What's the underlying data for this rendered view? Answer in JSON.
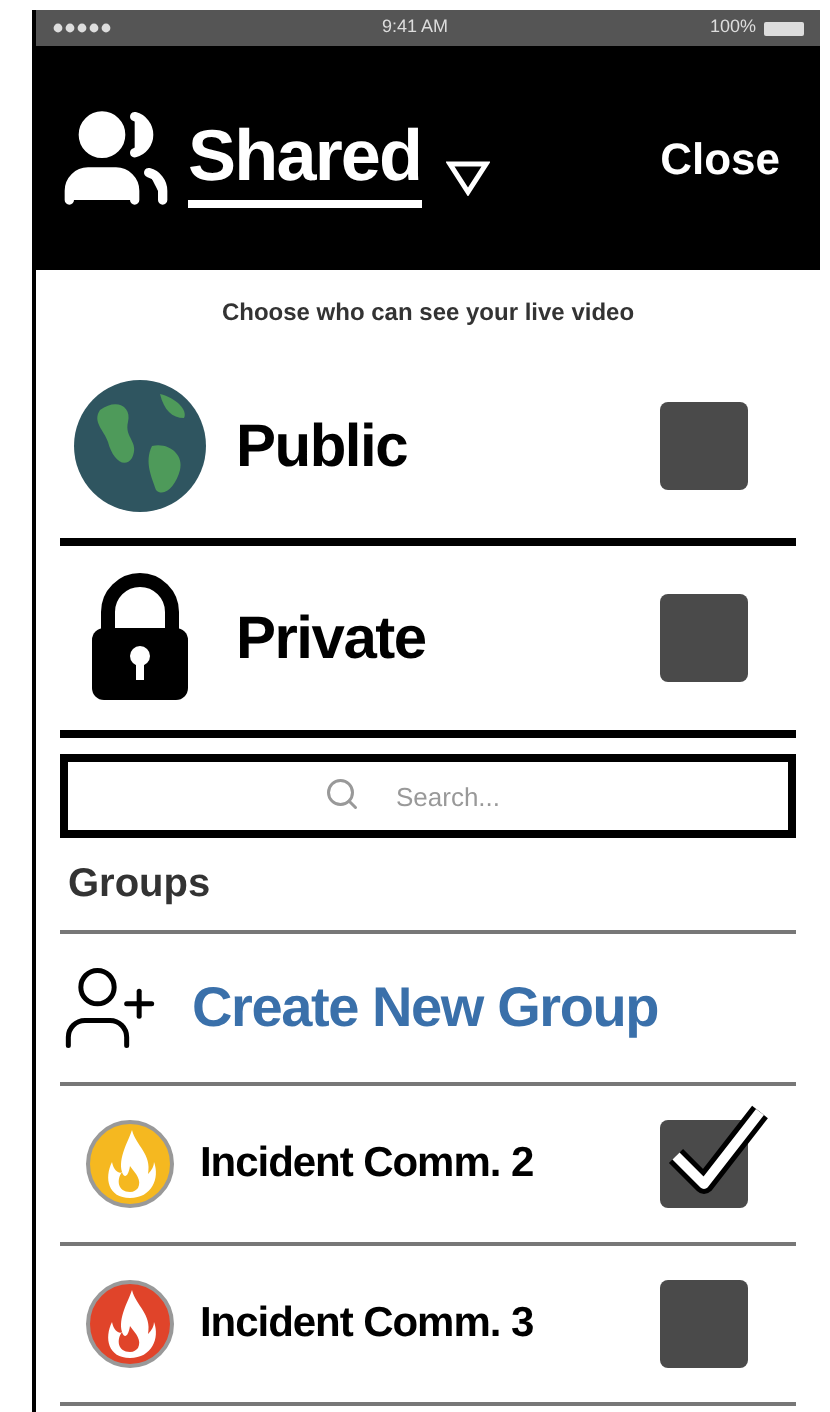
{
  "status_bar": {
    "time": "9:41 AM",
    "battery": "100%"
  },
  "header": {
    "title": "Shared",
    "close": "Close"
  },
  "subtitle": "Choose who can see your live video",
  "audience": [
    {
      "kind": "globe",
      "label": "Public",
      "checked": false
    },
    {
      "kind": "lock",
      "label": "Private",
      "checked": false
    }
  ],
  "search": {
    "placeholder": "Search..."
  },
  "groups_heading": "Groups",
  "create_group": "Create New Group",
  "groups": [
    {
      "label": "Incident Comm. 2",
      "checked": true,
      "color": "#f5b820"
    },
    {
      "label": "Incident Comm. 3",
      "checked": false,
      "color": "#e0442a"
    }
  ]
}
